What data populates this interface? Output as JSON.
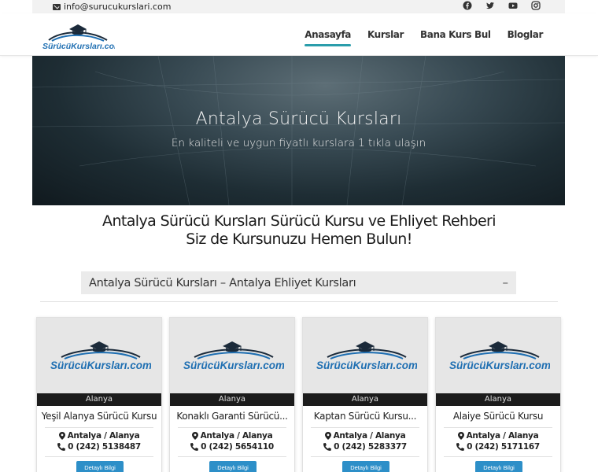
{
  "topbar": {
    "email": "info@surucukurslari.com",
    "social": [
      "facebook-icon",
      "twitter-icon",
      "youtube-icon",
      "instagram-icon"
    ]
  },
  "header": {
    "logo_text": "SürücüKursları.com",
    "nav": [
      {
        "label": "Anasayfa",
        "active": true
      },
      {
        "label": "Kurslar",
        "active": false
      },
      {
        "label": "Bana Kurs Bul",
        "active": false
      },
      {
        "label": "Bloglar",
        "active": false
      }
    ]
  },
  "hero": {
    "title": "Antalya Sürücü Kursları",
    "subtitle": "En kaliteli ve uygun fiyatlı kurslara 1 tıkla ulaşın"
  },
  "headline": {
    "line1": "Antalya Sürücü Kursları Sürücü Kursu ve Ehliyet Rehberi",
    "line2": "Siz de Kursunuzu Hemen Bulun!"
  },
  "accordion": {
    "title": "Antalya Sürücü Kursları – Antalya Ehliyet Kursları",
    "toggle": "–"
  },
  "cards": [
    {
      "logo_text": "SürücüKursları.com",
      "region": "Alanya",
      "name": "Yeşil Alanya Sürücü Kursu",
      "location": "Antalya / Alanya",
      "phone": "0 (242) 5138487",
      "button": "Detaylı Bilgi"
    },
    {
      "logo_text": "SürücüKursları.com",
      "region": "Alanya",
      "name": "Konaklı Garanti Sürücü...",
      "location": "Antalya / Alanya",
      "phone": "0 (242) 5654110",
      "button": "Detaylı Bilgi"
    },
    {
      "logo_text": "SürücüKursları.com",
      "region": "Alanya",
      "name": "Kaptan Sürücü Kursu...",
      "location": "Antalya / Alanya",
      "phone": "0 (242) 5283377",
      "button": "Detaylı Bilgi"
    },
    {
      "logo_text": "SürücüKursları.com",
      "region": "Alanya",
      "name": "Alaiye Sürücü Kursu",
      "location": "Antalya / Alanya",
      "phone": "0 (242) 5171167",
      "button": "Detaylı Bilgi"
    }
  ],
  "colors": {
    "accent": "#2a9dab",
    "button": "#2d8fc8",
    "logo_blue": "#1f6fb2",
    "region_bar": "#1c1c1c"
  }
}
